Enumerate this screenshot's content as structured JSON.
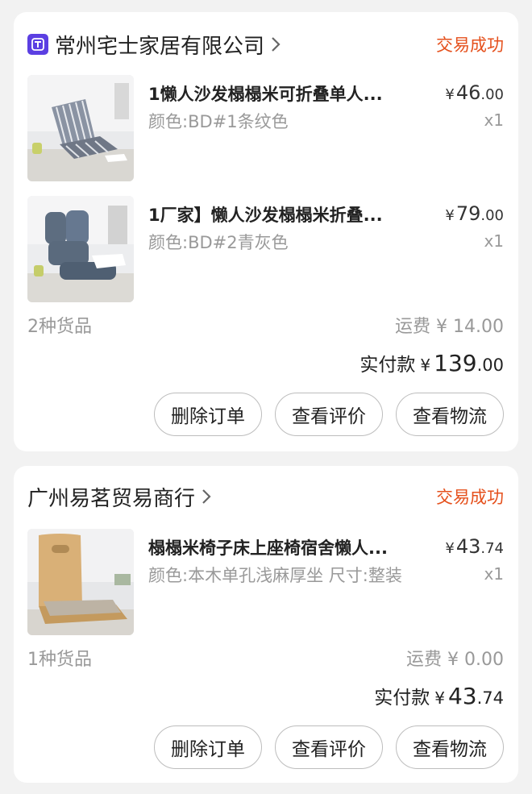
{
  "orders": [
    {
      "shop_name": "常州宅士家居有限公司",
      "status": "交易成功",
      "items": [
        {
          "title": "1懒人沙发榻榻米可折叠单人...",
          "spec": "颜色:BD#1条纹色",
          "price_currency": "¥",
          "price_int": "46",
          "price_dec": ".00",
          "qty": "x1"
        },
        {
          "title": "1厂家】懒人沙发榻榻米折叠...",
          "spec": "颜色:BD#2青灰色",
          "price_currency": "¥",
          "price_int": "79",
          "price_dec": ".00",
          "qty": "x1"
        }
      ],
      "item_count": "2种货品",
      "shipping": "运费 ¥ 14.00",
      "total_label": "实付款",
      "total_currency": "¥",
      "total_int": "139",
      "total_dec": ".00",
      "buttons": [
        "删除订单",
        "查看评价",
        "查看物流"
      ]
    },
    {
      "shop_name": "广州易茗贸易商行",
      "status": "交易成功",
      "items": [
        {
          "title": "榻榻米椅子床上座椅宿舍懒人...",
          "spec": "颜色:本木单孔浅麻厚坐 尺寸:整装",
          "price_currency": "¥",
          "price_int": "43",
          "price_dec": ".74",
          "qty": "x1"
        }
      ],
      "item_count": "1种货品",
      "shipping": "运费 ¥ 0.00",
      "total_label": "实付款",
      "total_currency": "¥",
      "total_int": "43",
      "total_dec": ".74",
      "buttons": [
        "删除订单",
        "查看评价",
        "查看物流"
      ]
    }
  ],
  "icons": {
    "shop_logo": "shop-logo-icon",
    "chevron": "chevron-right-icon"
  },
  "colors": {
    "status": "#e5501c",
    "logo_bg": "#5b3fe2",
    "page_bg": "#f2f2f2"
  }
}
